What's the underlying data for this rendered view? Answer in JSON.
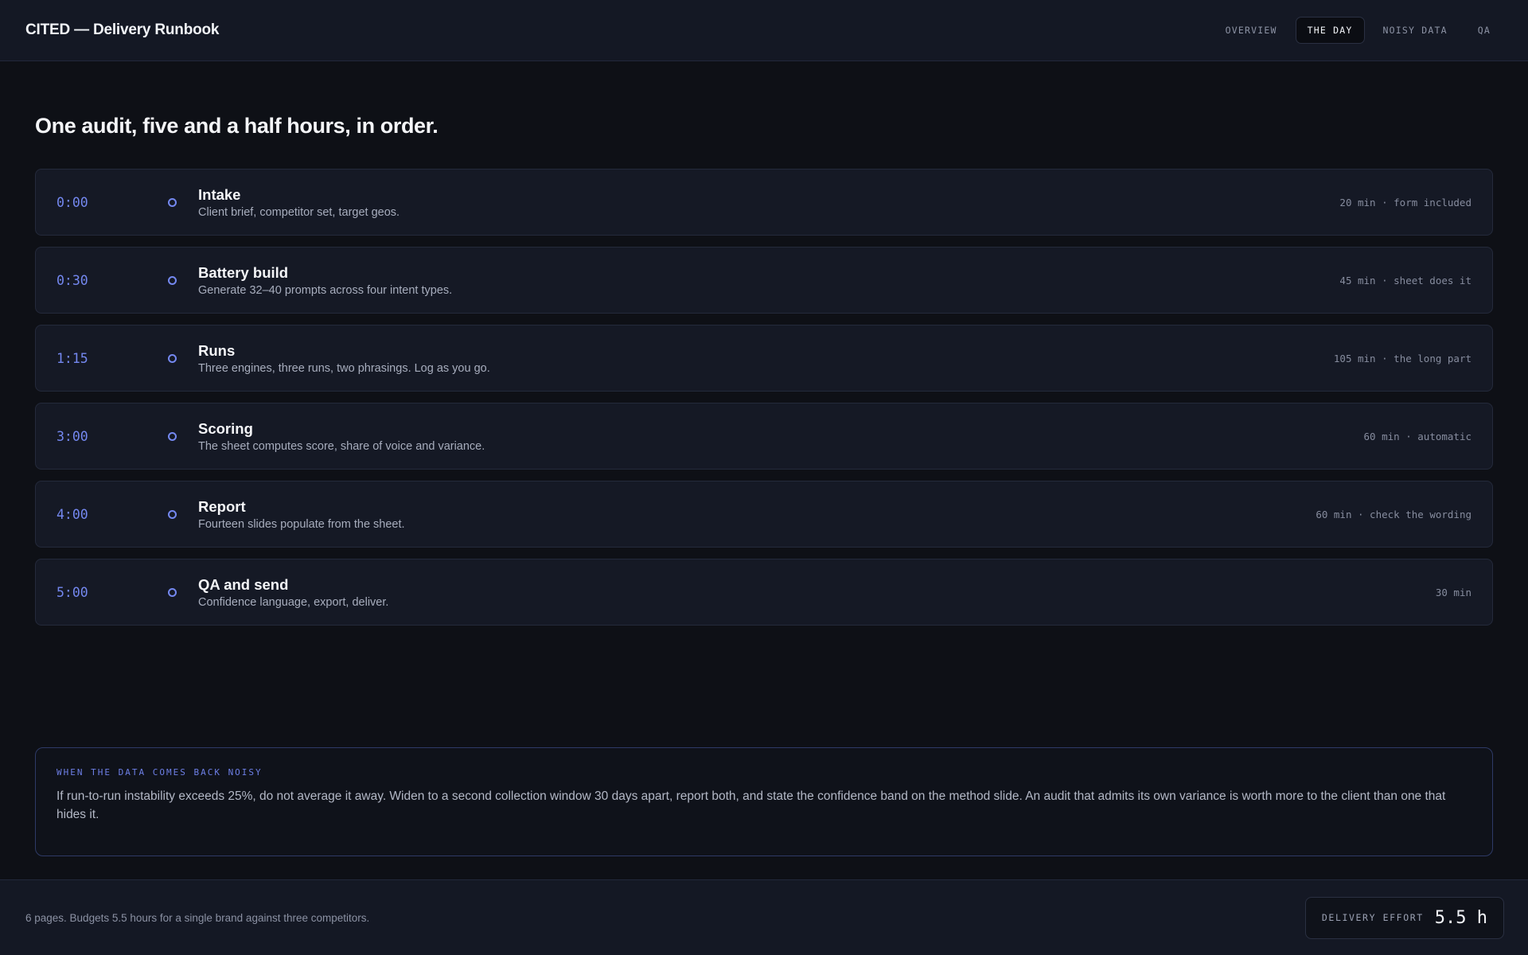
{
  "header": {
    "brand": "CITED — Delivery Runbook",
    "tabs": [
      {
        "label": "OVERVIEW",
        "active": false
      },
      {
        "label": "THE DAY",
        "active": true
      },
      {
        "label": "NOISY DATA",
        "active": false
      },
      {
        "label": "QA",
        "active": false
      }
    ]
  },
  "main": {
    "title": "One audit, five and a half hours, in order.",
    "steps": [
      {
        "time": "0:00",
        "title": "Intake",
        "desc": "Client brief, competitor set, target geos.",
        "meta": "20 min · form included"
      },
      {
        "time": "0:30",
        "title": "Battery build",
        "desc": "Generate 32–40 prompts across four intent types.",
        "meta": "45 min · sheet does it"
      },
      {
        "time": "1:15",
        "title": "Runs",
        "desc": "Three engines, three runs, two phrasings. Log as you go.",
        "meta": "105 min · the long part"
      },
      {
        "time": "3:00",
        "title": "Scoring",
        "desc": "The sheet computes score, share of voice and variance.",
        "meta": "60 min · automatic"
      },
      {
        "time": "4:00",
        "title": "Report",
        "desc": "Fourteen slides populate from the sheet.",
        "meta": "60 min · check the wording"
      },
      {
        "time": "5:00",
        "title": "QA and send",
        "desc": "Confidence language, export, deliver.",
        "meta": "30 min"
      }
    ]
  },
  "callout": {
    "label": "WHEN THE DATA COMES BACK NOISY",
    "body": "If run-to-run instability exceeds 25%, do not average it away. Widen to a second collection window 30 days apart, report both, and state the confidence band on the method slide. An audit that admits its own variance is worth more to the client than one that hides it."
  },
  "footer": {
    "note": "6 pages. Budgets 5.5 hours for a single brand against three competitors.",
    "effort_label": "DELIVERY EFFORT",
    "effort_value": "5.5 h"
  },
  "colors": {
    "accent": "#7488f0",
    "background": "#0e1016",
    "card": "#151925"
  }
}
